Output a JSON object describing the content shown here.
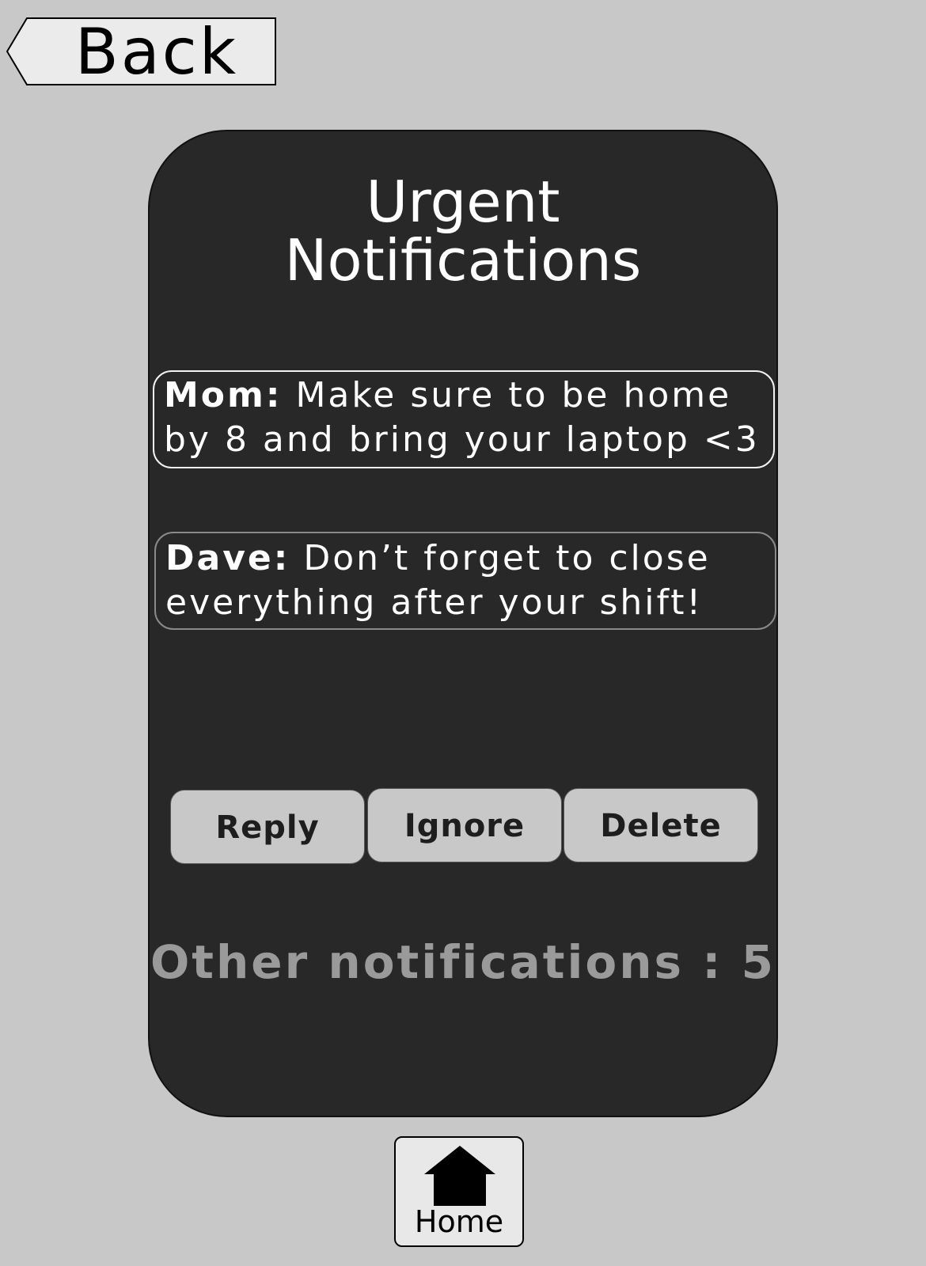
{
  "nav": {
    "back_label": "Back",
    "home_label": "Home"
  },
  "card": {
    "title_line1": "Urgent",
    "title_line2": "Notifications",
    "notifications": [
      {
        "sender": "Mom:",
        "line1": " Make sure to be home",
        "line2": "by 8 and bring your laptop <3"
      },
      {
        "sender": "Dave:",
        "line1": " Don’t forget to close",
        "line2": "everything after your shift!"
      }
    ],
    "actions": {
      "reply": "Reply",
      "ignore": "Ignore",
      "delete": "Delete"
    },
    "other_notifications": "Other notifications : 5"
  },
  "icons": {
    "back": "back-arrow-icon",
    "home": "home-icon"
  },
  "colors": {
    "background": "#c8c8c8",
    "card": "#282828",
    "button": "#c8c8c8",
    "muted_text": "#9a9a9a"
  }
}
